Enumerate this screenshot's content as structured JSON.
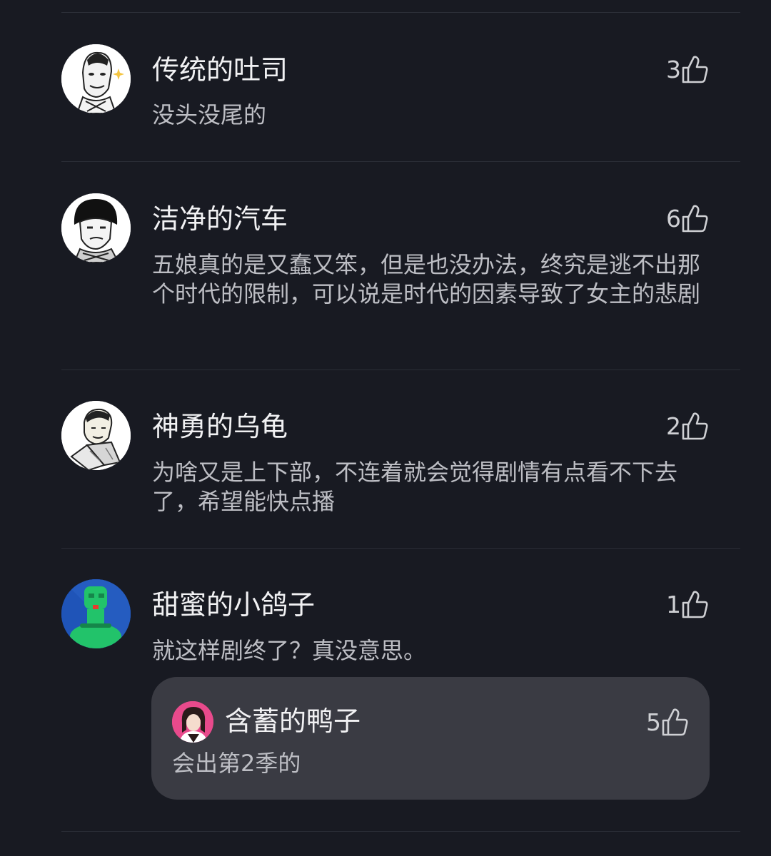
{
  "comments": [
    {
      "username": "传统的吐司",
      "content": "没头没尾的",
      "likes": "3",
      "avatar_icon": "meme-face-avatar"
    },
    {
      "username": "洁净的汽车",
      "content": "五娘真的是又蠢又笨，但是也没办法，终究是逃不出那个时代的限制，可以说是时代的因素导致了女主的悲剧",
      "likes": "6",
      "avatar_icon": "meme-face-avatar"
    },
    {
      "username": "神勇的乌龟",
      "content": "为啥又是上下部，不连着就会觉得剧情有点看不下去了，希望能快点播",
      "likes": "2",
      "avatar_icon": "meme-face-avatar"
    },
    {
      "username": "甜蜜的小鸽子",
      "content": "就这样剧终了？真没意思。",
      "likes": "1",
      "avatar_icon": "green-robot-avatar",
      "reply": {
        "username": "含蓄的鸭子",
        "content": "会出第2季的",
        "likes": "5",
        "avatar_icon": "girl-avatar"
      }
    }
  ],
  "icons": {
    "like": "thumbs-up-icon"
  },
  "colors": {
    "background": "#181a22",
    "reply_background": "#3a3b43",
    "divider": "#2b2e37"
  }
}
